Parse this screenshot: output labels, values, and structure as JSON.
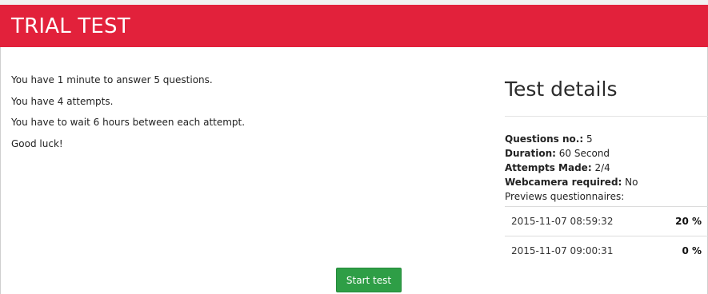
{
  "header": {
    "title": "TRIAL TEST"
  },
  "intro": {
    "lines": [
      "You have 1 minute to answer 5 questions.",
      "You have 4 attempts.",
      "You have to wait 6 hours between each attempt.",
      "Good luck!"
    ]
  },
  "details": {
    "title": "Test details",
    "questions_label": "Questions no.:",
    "questions_value": "5",
    "duration_label": "Duration:",
    "duration_value": "60 Second",
    "attempts_label": "Attempts Made:",
    "attempts_value": "2/4",
    "webcam_label": "Webcamera required:",
    "webcam_value": "No",
    "previews_label": "Previews questionnaires:",
    "history": [
      {
        "date": "2015-11-07 08:59:32",
        "score": "20 %"
      },
      {
        "date": "2015-11-07 09:00:31",
        "score": "0 %"
      }
    ]
  },
  "actions": {
    "start_label": "Start test"
  },
  "colors": {
    "header_bg": "#e2213b",
    "button_bg": "#2e9e46"
  }
}
